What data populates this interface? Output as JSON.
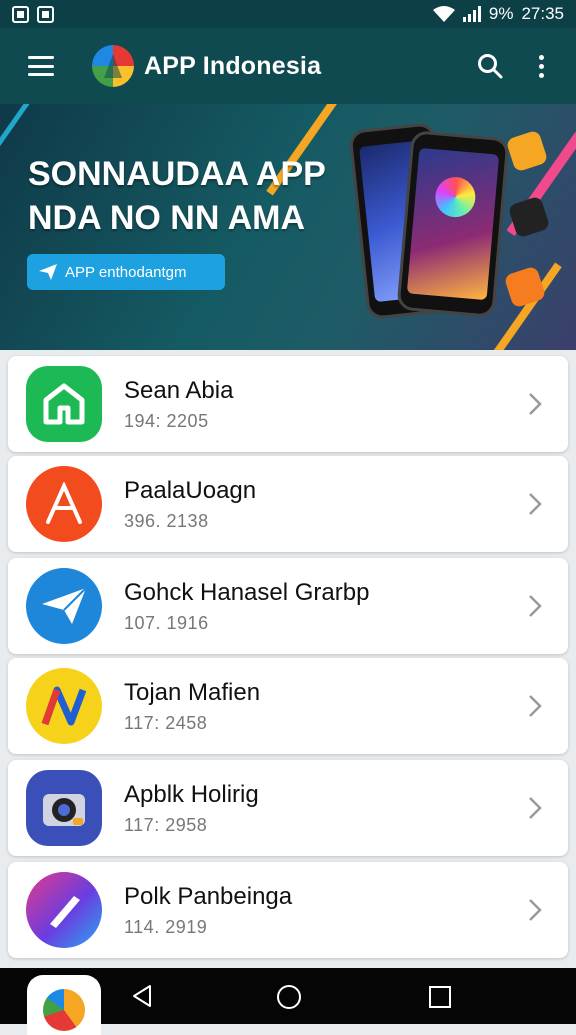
{
  "status_bar": {
    "battery": "9%",
    "time": "27:35"
  },
  "app_bar": {
    "title": "APP Indonesia"
  },
  "banner": {
    "headline_line1": "SONNAUDAA APP",
    "headline_line2": "NDA NO NN AMA",
    "button_label": "APP enthodantgm"
  },
  "apps": [
    {
      "name": "Sean Abia",
      "meta": "194: 2205",
      "icon": "house-icon",
      "color": "#1db954"
    },
    {
      "name": "PaalaUoagn",
      "meta": "396. 2138",
      "icon": "letter-a-icon",
      "color": "#f24b1e"
    },
    {
      "name": "Gohck Hanasel Grarbp",
      "meta": "107. 1916",
      "icon": "paper-plane-icon",
      "color": "#1f87d9"
    },
    {
      "name": "Tojan Mafien",
      "meta": "117: 2458",
      "icon": "n-logo-icon",
      "color": "#f7d21a"
    },
    {
      "name": "Apblk Holirig",
      "meta": "117: 2958",
      "icon": "camera-icon",
      "color": "#3a4fb8"
    },
    {
      "name": "Polk Panbeinga",
      "meta": "114. 2919",
      "icon": "pen-icon",
      "color": "#7a3ec9"
    }
  ]
}
